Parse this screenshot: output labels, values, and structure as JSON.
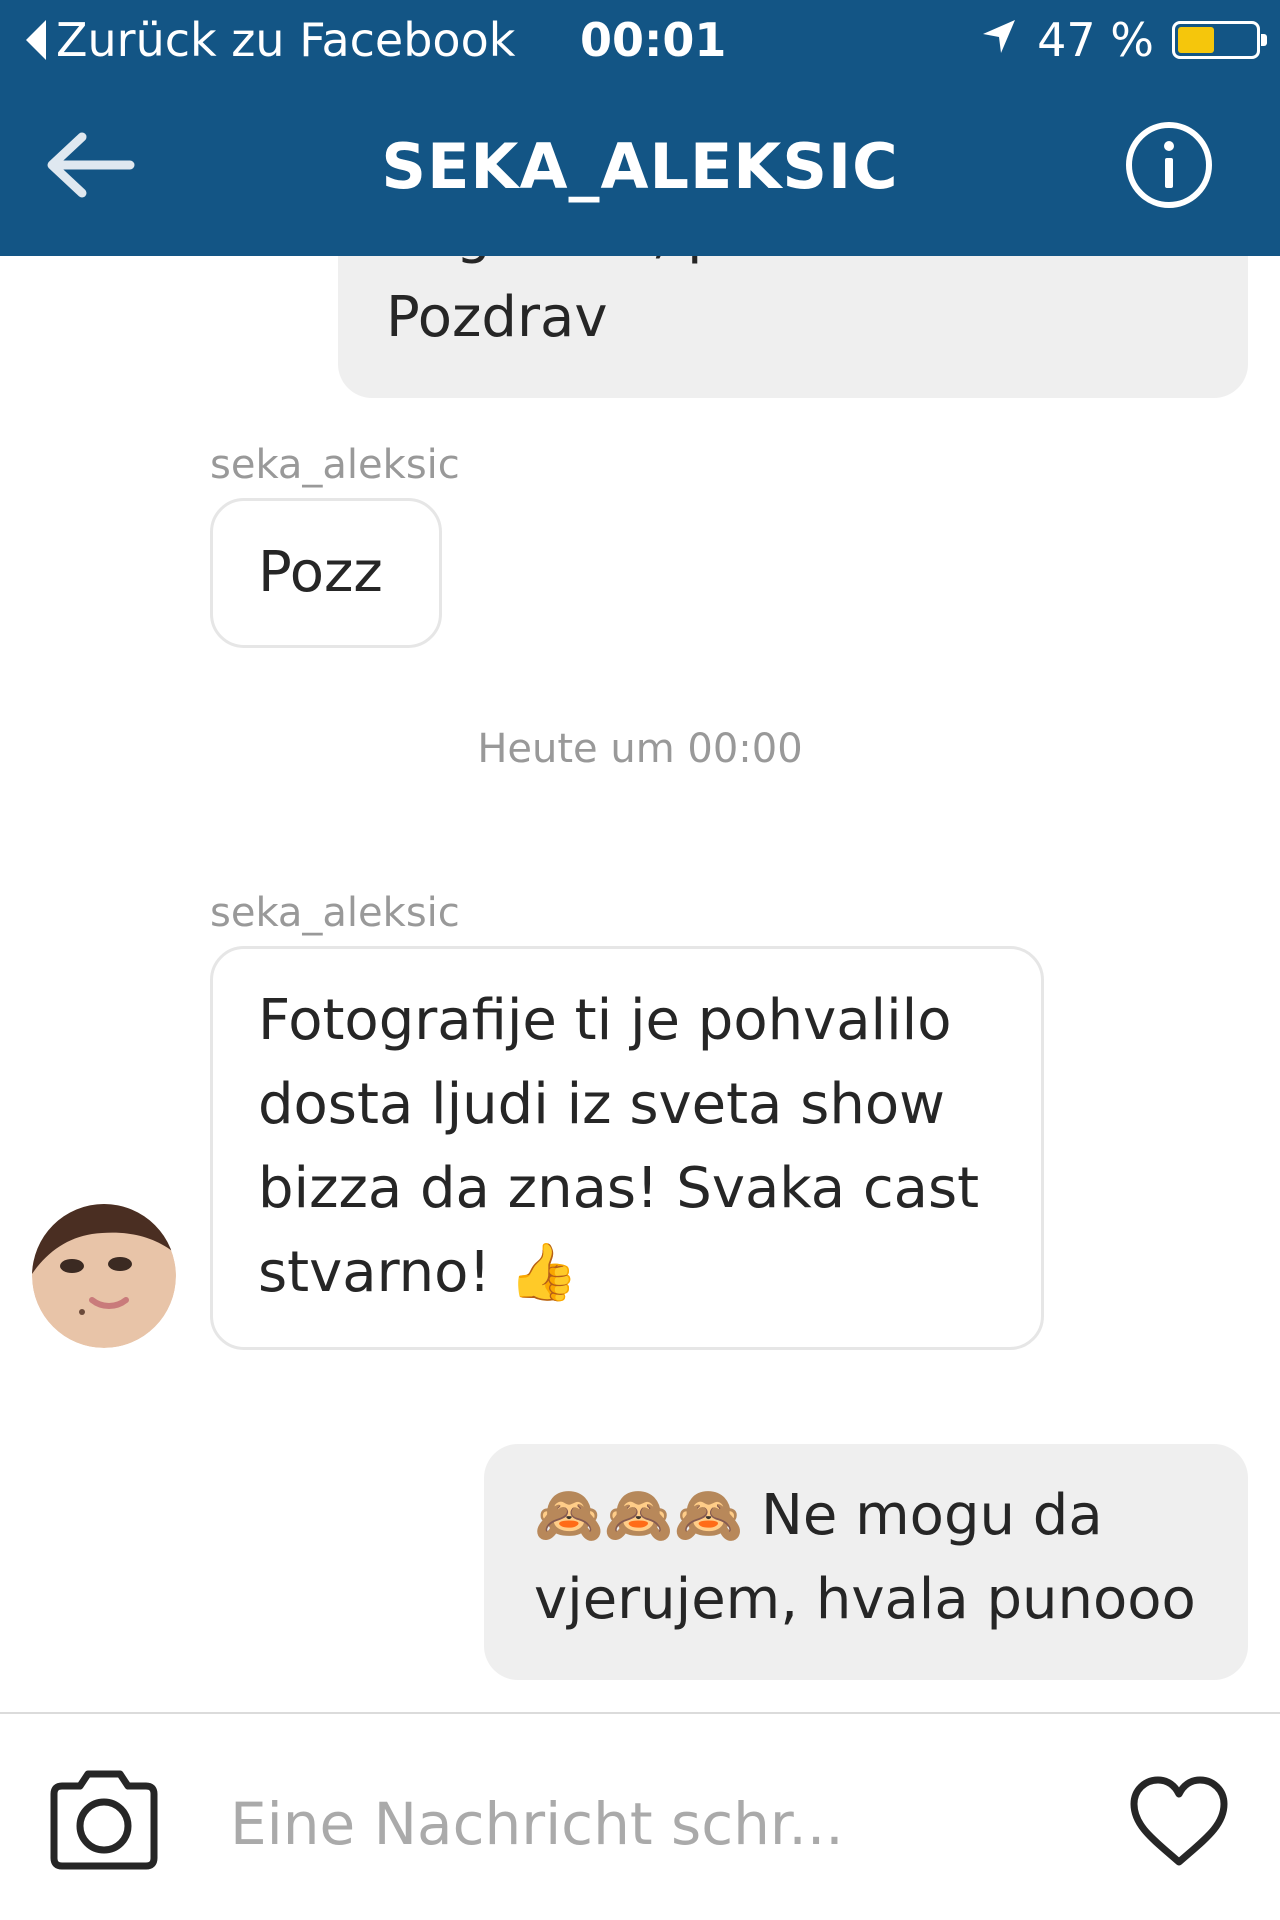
{
  "status_bar": {
    "back_label": "Zurück zu Facebook",
    "time": "00:01",
    "battery_text": "47 %",
    "battery_level": 0.47,
    "battery_color": "#f5c60c",
    "icons": [
      "back-triangle-icon",
      "location-arrow-icon",
      "battery-icon"
    ]
  },
  "nav": {
    "title": "SEKA_ALEKSIC",
    "icons": [
      "back-arrow-icon",
      "info-icon"
    ]
  },
  "conversation": {
    "outgoing_partial": "dogovoru, prenosim odmah! Pozdrav",
    "sender_1": "seka_aleksic",
    "incoming_1": "Pozz",
    "timestamp": "Heute um 00:00",
    "sender_2": "seka_aleksic",
    "incoming_2": "Fotografije ti je pohvalilo dosta ljudi iz sveta show bizza da znas! Svaka cast stvarno! 👍",
    "outgoing_2": "🙈🙈🙈 Ne mogu da vjerujem, hvala punooo"
  },
  "composer": {
    "placeholder": "Eine Nachricht schr...",
    "icons": [
      "camera-icon",
      "heart-icon"
    ]
  },
  "colors": {
    "header_bg": "#135585",
    "outgoing_bubble": "#efefef",
    "incoming_border": "#e6e6e6",
    "meta_text": "#999999"
  }
}
